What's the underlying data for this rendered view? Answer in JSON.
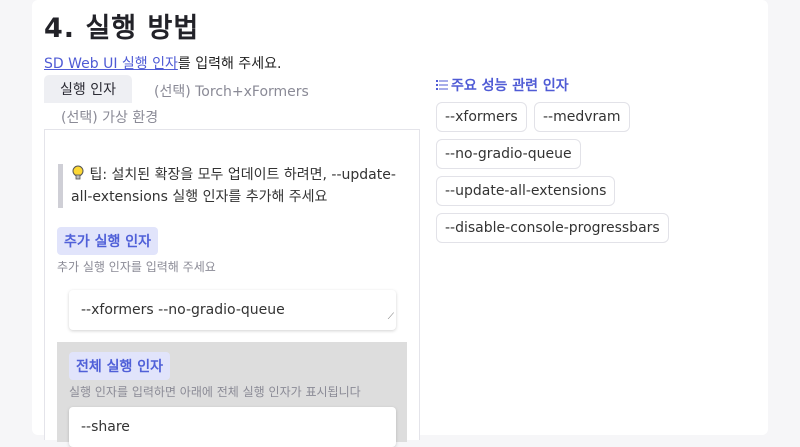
{
  "section": {
    "title": "4. 실행 방법"
  },
  "intro": {
    "link_text": "SD Web UI 실행 인자",
    "rest_text": "를 입력해 주세요."
  },
  "tabs": [
    {
      "label": "실행 인자",
      "active": true
    },
    {
      "label": "(선택) Torch+xFormers",
      "active": false
    },
    {
      "label": "(선택) 가상 환경",
      "active": false
    }
  ],
  "tip": {
    "icon": "lightbulb-icon",
    "text": "팁: 설치된 확장을 모두 업데이트 하려면, --update-all-extensions 실행 인자를 추가해 주세요"
  },
  "extra_args": {
    "label": "추가 실행 인자",
    "hint": "추가 실행 인자를 입력해 주세요",
    "value": "--xformers --no-gradio-queue"
  },
  "full_args": {
    "label": "전체 실행 인자",
    "hint": "실행 인자를 입력하면 아래에 전체 실행 인자가 표시됩니다",
    "value": "--share"
  },
  "performance": {
    "title": "주요 성능 관련 인자",
    "chips": [
      "--xformers",
      "--medvram",
      "--no-gradio-queue",
      "--update-all-extensions",
      "--disable-console-progressbars"
    ]
  },
  "colors": {
    "accent": "#4f5bd5",
    "badge_bg": "#e1e4fb",
    "shaded_bg": "#dddddd"
  }
}
